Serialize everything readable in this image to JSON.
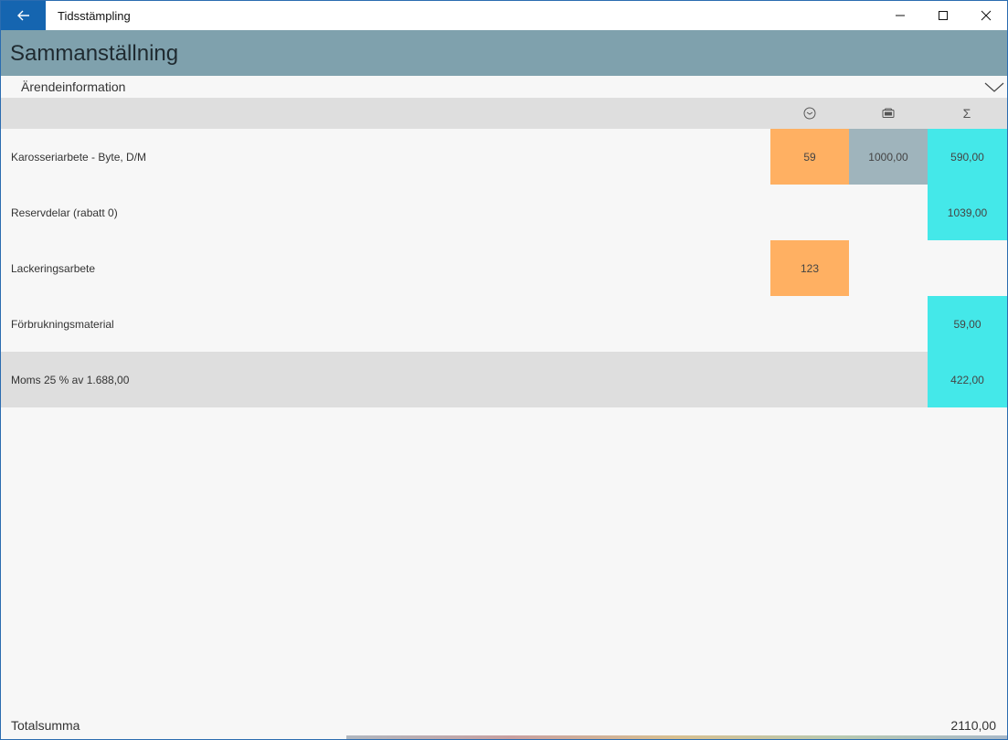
{
  "titlebar": {
    "title": "Tidsstämpling"
  },
  "header": {
    "title": "Sammanställning"
  },
  "info": {
    "label": "Ärendeinformation"
  },
  "columns": {
    "sum_symbol": "Σ"
  },
  "rows": [
    {
      "label": "Karosseriarbete - Byte, D/M",
      "time": "59",
      "price": "1000,00",
      "sum": "590,00"
    },
    {
      "label": "Reservdelar (rabatt 0)",
      "time": "",
      "price": "",
      "sum": "1039,00"
    },
    {
      "label": "Lackeringsarbete",
      "time": "123",
      "price": "",
      "sum": ""
    },
    {
      "label": "Förbrukningsmaterial",
      "time": "",
      "price": "",
      "sum": "59,00"
    },
    {
      "label": "Moms 25 % av 1.688,00",
      "time": "",
      "price": "",
      "sum": "422,00"
    }
  ],
  "footer": {
    "label": "Totalsumma",
    "value": "2110,00"
  },
  "colors": {
    "accent": "#1565b0",
    "header": "#7fa1ad",
    "time": "#ffb062",
    "price": "#9fb4bc",
    "sum": "#44e8e9"
  }
}
